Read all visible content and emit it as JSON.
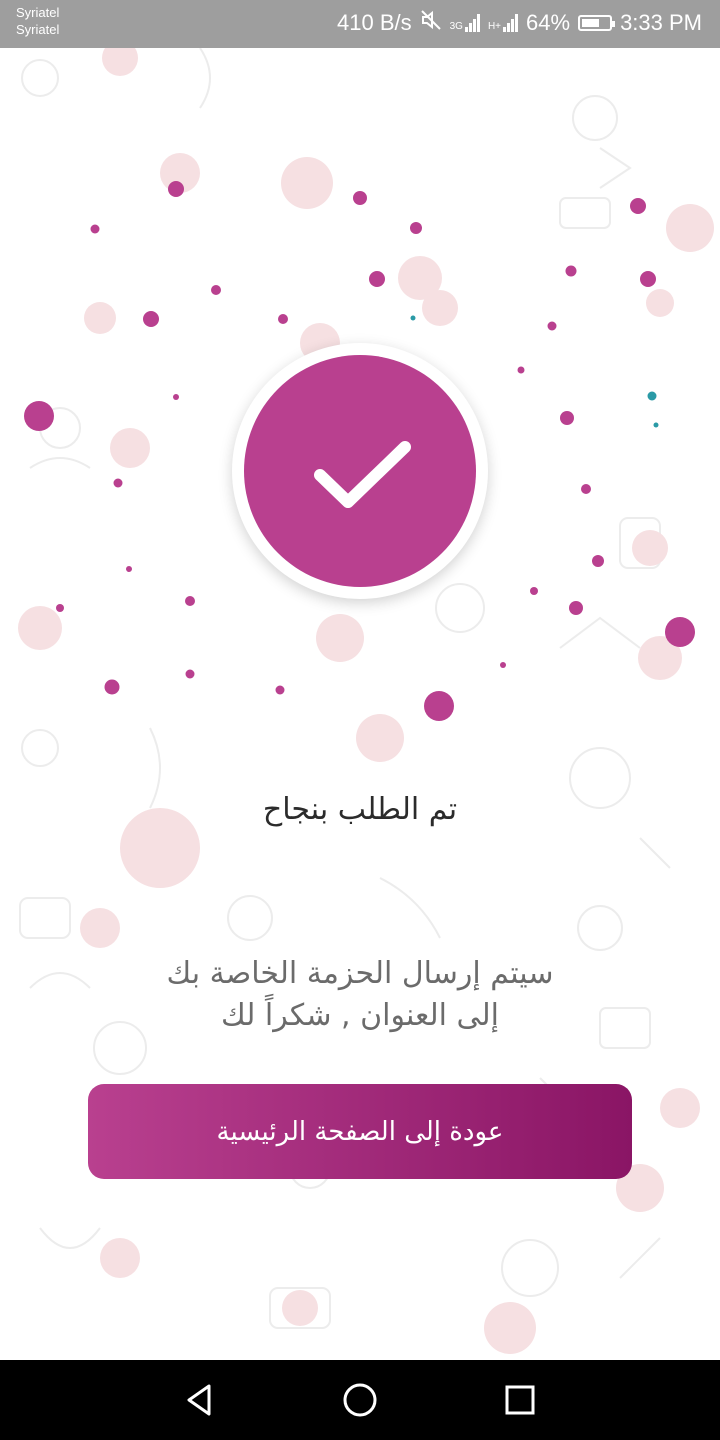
{
  "status_bar": {
    "carrier_1": "Syriatel",
    "carrier_2": "Syriatel",
    "net_speed": "410 B/s",
    "net_3g": "3G",
    "net_hplus": "H+",
    "battery": "64%",
    "battery_level": 0.64,
    "time": "3:33 PM"
  },
  "success": {
    "title": "تم الطلب بنجاح",
    "message_line_1": "سيتم إرسال الحزمة الخاصة بك",
    "message_line_2": "إلى العنوان , شكراً لك"
  },
  "actions": {
    "home_label": "عودة إلى الصفحة الرئيسية"
  },
  "colors": {
    "accent": "#b9408f",
    "accent_dark": "#8a1565",
    "teal_dot": "#2a9aa6",
    "pattern": "#f2d7d9"
  },
  "icons": {
    "success": "check-icon",
    "nav_back": "triangle-back-icon",
    "nav_home": "circle-home-icon",
    "nav_recent": "square-recents-icon",
    "mute": "mute-icon"
  }
}
